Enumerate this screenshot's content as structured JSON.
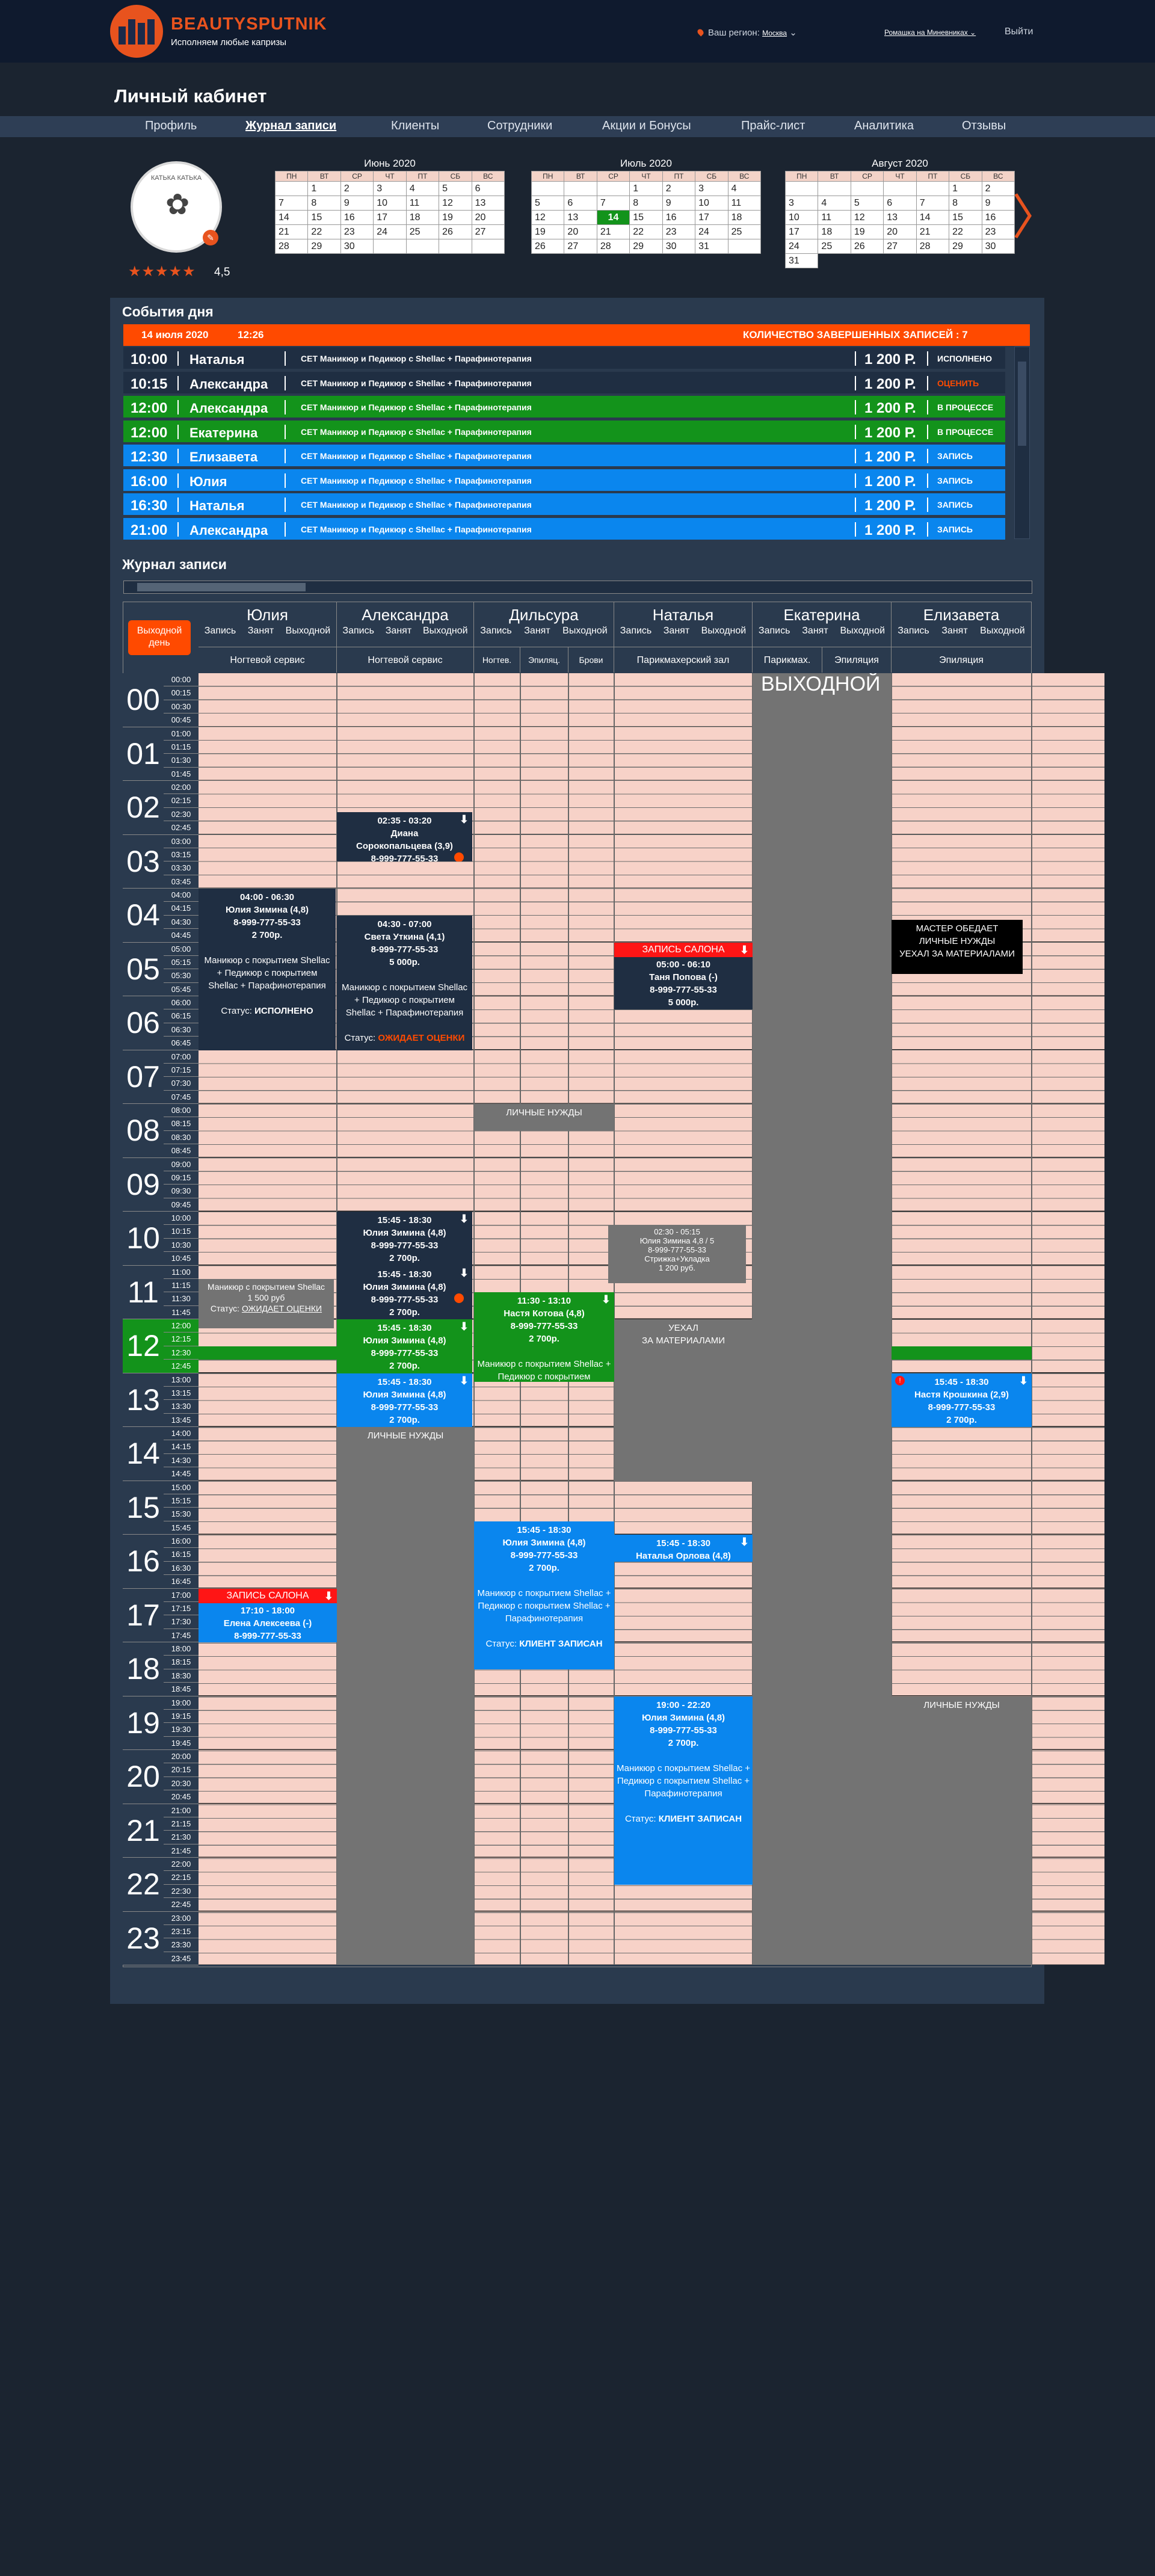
{
  "header": {
    "brand": "BEAUTYSPUTNIK",
    "tagline": "Исполняем любые капризы",
    "region_label": "Ваш регион:",
    "region": "Москва",
    "salon": "Ромашка на Миневниках",
    "logout": "Выйти"
  },
  "page_title": "Личный кабинет",
  "nav": [
    "Профиль",
    "Журнал записи",
    "Клиенты",
    "Сотрудники",
    "Акции и Бонусы",
    "Прайс-лист",
    "Аналитика",
    "Отзывы"
  ],
  "profile": {
    "avatar_text": "КАТЬКА КАТЬКА",
    "stars": "★★★★★",
    "rating": "4,5"
  },
  "calendars": [
    {
      "title": "Июнь 2020",
      "days": [
        "",
        "1",
        "2",
        "3",
        "4",
        "5",
        "6",
        "7",
        "8",
        "9",
        "10",
        "11",
        "12",
        "13",
        "14",
        "15",
        "16",
        "17",
        "18",
        "19",
        "20",
        "21",
        "22",
        "23",
        "24",
        "25",
        "26",
        "27",
        "28",
        "29",
        "30",
        "",
        "",
        "",
        ""
      ]
    },
    {
      "title": "Июль 2020",
      "days": [
        "",
        "",
        "",
        "1",
        "2",
        "3",
        "4",
        "5",
        "6",
        "7",
        "8",
        "9",
        "10",
        "11",
        "12",
        "13",
        "14",
        "15",
        "16",
        "17",
        "18",
        "19",
        "20",
        "21",
        "22",
        "23",
        "24",
        "25",
        "26",
        "27",
        "28",
        "29",
        "30",
        "31",
        ""
      ],
      "selected": "14"
    },
    {
      "title": "Август 2020",
      "days": [
        "",
        "",
        "",
        "",
        "",
        "1",
        "2",
        "3",
        "4",
        "5",
        "6",
        "7",
        "8",
        "9",
        "10",
        "11",
        "12",
        "13",
        "14",
        "15",
        "16",
        "17",
        "18",
        "19",
        "20",
        "21",
        "22",
        "23",
        "24",
        "25",
        "26",
        "27",
        "28",
        "29",
        "30",
        "31"
      ]
    }
  ],
  "weekdays": [
    "ПН",
    "ВТ",
    "СР",
    "ЧТ",
    "ПТ",
    "СБ",
    "ВС"
  ],
  "events": {
    "title": "События дня",
    "date": "14 июля 2020",
    "time": "12:26",
    "count_label": "КОЛИЧЕСТВО ЗАВЕРШЕННЫХ ЗАПИСЕЙ : 7",
    "rows": [
      {
        "time": "10:00",
        "name": "Наталья",
        "service": "СЕТ Маникюр и Педикюр с Shellac + Парафинотерапия",
        "price": "1 200 Р.",
        "status": "ИСПОЛНЕНО",
        "color": "#1f2e42",
        "scolor": "#ffffff"
      },
      {
        "time": "10:15",
        "name": "Александра",
        "service": "СЕТ Маникюр и Педикюр с Shellac + Парафинотерапия",
        "price": "1 200 Р.",
        "status": "ОЦЕНИТЬ",
        "color": "#1f2e42",
        "scolor": "#ff4a00"
      },
      {
        "time": "12:00",
        "name": "Александра",
        "service": "СЕТ Маникюр и Педикюр с Shellac + Парафинотерапия",
        "price": "1 200 Р.",
        "status": "В ПРОЦЕССЕ",
        "color": "#13931b",
        "scolor": "#ffffff"
      },
      {
        "time": "12:00",
        "name": "Екатерина",
        "service": "СЕТ Маникюр и Педикюр с Shellac + Парафинотерапия",
        "price": "1 200 Р.",
        "status": "В ПРОЦЕССЕ",
        "color": "#13931b",
        "scolor": "#ffffff"
      },
      {
        "time": "12:30",
        "name": "Елизавета",
        "service": "СЕТ Маникюр и Педикюр с Shellac + Парафинотерапия",
        "price": "1 200 Р.",
        "status": "ЗАПИСЬ",
        "color": "#0a86ee",
        "scolor": "#ffffff"
      },
      {
        "time": "16:00",
        "name": "Юлия",
        "service": "СЕТ Маникюр и Педикюр с Shellac + Парафинотерапия",
        "price": "1 200 Р.",
        "status": "ЗАПИСЬ",
        "color": "#0a86ee",
        "scolor": "#ffffff"
      },
      {
        "time": "16:30",
        "name": "Наталья",
        "service": "СЕТ Маникюр и Педикюр с Shellac + Парафинотерапия",
        "price": "1 200 Р.",
        "status": "ЗАПИСЬ",
        "color": "#0a86ee",
        "scolor": "#ffffff"
      },
      {
        "time": "21:00",
        "name": "Александра",
        "service": "СЕТ Маникюр и Педикюр с Shellac + Парафинотерапия",
        "price": "1 200 Р.",
        "status": "ЗАПИСЬ",
        "color": "#0a86ee",
        "scolor": "#ffffff"
      }
    ]
  },
  "journal": {
    "title": "Журнал записи",
    "dayoff_button": "Выходной день",
    "sub_cols": [
      "Запись",
      "Занят",
      "Выходной"
    ],
    "masters": [
      "Юлия",
      "Александра",
      "Дильсура",
      "Наталья",
      "Екатерина",
      "Елизавета"
    ],
    "rooms": [
      "Ногтевой сервис",
      "Ногтевой сервис",
      "Ногтев.",
      "Эпиляц.",
      "Брови",
      "Парикмахерский зал",
      "Парикмах.",
      "Эпиляция",
      "Эпиляция"
    ],
    "hours": [
      "00",
      "01",
      "02",
      "03",
      "04",
      "05",
      "06",
      "07",
      "08",
      "09",
      "10",
      "11",
      "12",
      "13",
      "14",
      "15",
      "16",
      "17",
      "18",
      "19",
      "20",
      "21",
      "22",
      "23"
    ],
    "quarters": [
      "00",
      "15",
      "30",
      "45"
    ],
    "current_hour": "12",
    "blocks": {
      "b1": [
        "02:35 - 03:20",
        "Диана",
        "Сорокопальцева  (3,9)",
        "8-999-777-55-33"
      ],
      "b2": [
        "04:00 - 06:30",
        "Юлия Зимина  (4,8)",
        "8-999-777-55-33",
        "2 700р.",
        "Маникюр с покрытием Shellac  + Педикюр с покрытием Shellac + Парафинотерапия",
        "Статус:",
        "ИСПОЛНЕНО"
      ],
      "b3": [
        "04:30 - 07:00",
        "Света Уткина  (4,1)",
        "8-999-777-55-33",
        "5 000р.",
        "Маникюр с покрытием Shellac  + Педикюр с покрытием Shellac + Парафинотерапия",
        "Статус:",
        "ОЖИДАЕТ ОЦЕНКИ"
      ],
      "b4": [
        "ЗАПИСЬ САЛОНА",
        "05:00 - 06:10",
        "Таня Попова  (-)",
        "8-999-777-55-33",
        "5 000р."
      ],
      "b5": [
        "МАСТЕР ОБЕДАЕТ",
        "ЛИЧНЫЕ НУЖДЫ",
        "УЕХАЛ ЗА МАТЕРИАЛАМИ"
      ],
      "lichn": "ЛИЧНЫЕ НУЖДЫ",
      "b6": [
        "15:45 - 18:30",
        "Юлия Зимина  (4,8)",
        "8-999-777-55-33",
        "2 700р."
      ],
      "b9": [
        "02:30 - 05:15",
        "Юлия Зимина     4,8 / 5",
        "8-999-777-55-33",
        "Стрижка+Укладка",
        "1 200 руб."
      ],
      "b10": [
        "Маникюр с покрытием Shellac",
        "1 500 руб",
        "Статус:",
        "ОЖИДАЕТ ОЦЕНКИ"
      ],
      "b11": [
        "11:30 - 13:10",
        "Настя Котова  (4,8)",
        "8-999-777-55-33",
        "2 700р.",
        "Маникюр с покрытием Shellac  + Педикюр с покрытием"
      ],
      "uehal": [
        "УЕХАЛ",
        "ЗА МАТЕРИАЛАМИ"
      ],
      "b14": [
        "15:45 - 18:30",
        "Настя Крошкина  (2,9)",
        "8-999-777-55-33",
        "2 700р."
      ],
      "b15": [
        "15:45 - 18:30",
        "Юлия Зимина  (4,8)",
        "8-999-777-55-33",
        "2 700р.",
        "Маникюр с покрытием Shellac  + Педикюр с покрытием Shellac + Парафинотерапия",
        "Статус:",
        "КЛИЕНТ ЗАПИСАН"
      ],
      "b16": [
        "15:45 - 18:30",
        "Наталья Орлова  (4,8)"
      ],
      "b17": [
        "ЗАПИСЬ САЛОНА",
        "17:10 - 18:00",
        "Елена Алексеева  (-)",
        "8-999-777-55-33"
      ],
      "b18": [
        "19:00 - 22:20",
        "Юлия Зимина  (4,8)",
        "8-999-777-55-33",
        "2 700р.",
        "Маникюр с покрытием Shellac  + Педикюр с покрытием Shellac + Парафинотерапия",
        "Статус:",
        "КЛИЕНТ ЗАПИСАН"
      ],
      "vykhodnoy": "ВЫХОДНОЙ"
    }
  }
}
